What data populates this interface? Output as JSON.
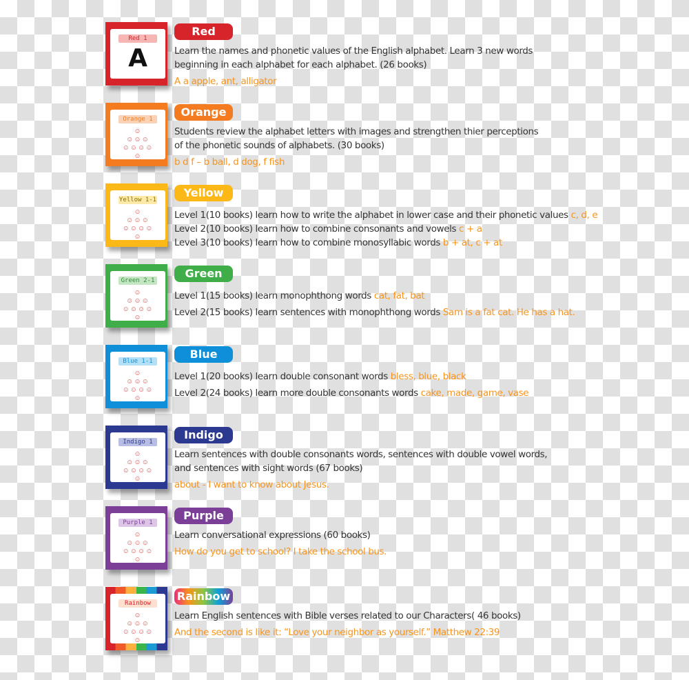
{
  "rows": [
    {
      "label": "Red",
      "color": "#d7232a",
      "cover_title": "Red 1",
      "title_bg": "#f7b6b4",
      "title_color": "#d7232a",
      "cover_letter": "A",
      "lines": [
        {
          "t": "Learn the names and phonetic values of the English alphabet. Learn 3 new words",
          "h": ""
        },
        {
          "t": "beginning in each alphabet for each alphabet. (26 books)",
          "h": ""
        },
        {
          "t": "",
          "h": "A a apple, ant, alligator",
          "gap": true
        }
      ]
    },
    {
      "label": "Orange",
      "color": "#f47b20",
      "cover_title": "Orange 1",
      "title_bg": "#fcd2b4",
      "title_color": "#f47b20",
      "lines": [
        {
          "t": "Students review the alphabet letters with images and strengthen thier perceptions",
          "h": ""
        },
        {
          "t": "of the phonetic sounds of alphabets. (30 books)",
          "h": ""
        },
        {
          "t": "",
          "h": "b d f – b ball, d dog, f fish",
          "gap": true
        }
      ]
    },
    {
      "label": "Yellow",
      "color": "#fbb817",
      "cover_title": "Yellow 1-1",
      "title_bg": "#fde9a8",
      "title_color": "#8a6d00",
      "lines": [
        {
          "t": "Level 1(10 books) learn how to write the alphabet in lower case and their phonetic values ",
          "h": "c, d, e",
          "gap": true
        },
        {
          "t": "Level 2(10 books) learn how to combine consonants and vowels ",
          "h": "c + a"
        },
        {
          "t": "Level 3(10 books) learn how to combine monosyllabic words ",
          "h": "b + at, c + at"
        }
      ]
    },
    {
      "label": "Green",
      "color": "#3fae49",
      "cover_title": "Green 2-1",
      "title_bg": "#c5e6c2",
      "title_color": "#2d8a37",
      "lines": [
        {
          "t": "Level 1(15 books) learn monophthong words ",
          "h": "cat, fat, bat",
          "gap": true
        },
        {
          "t": "Level 2(15 books) learn sentences with monophthong words ",
          "h": "Sam is a fat cat. He has a hat.",
          "gap": true
        }
      ]
    },
    {
      "label": "Blue",
      "color": "#0f8fd7",
      "cover_title": "Blue 1-1",
      "title_bg": "#b3e0f7",
      "title_color": "#0f8fd7",
      "lines": [
        {
          "t": "Level 1(20 books) learn double consonant words ",
          "h": "bless, blue, black",
          "gap": true
        },
        {
          "t": "Level 2(24 books) learn more double consonants words ",
          "h": "cake, made, game, vase",
          "gap": true
        }
      ]
    },
    {
      "label": "Indigo",
      "color": "#2b3990",
      "cover_title": "Indigo 1",
      "title_bg": "#b7bde3",
      "title_color": "#2b3990",
      "lines": [
        {
          "t": "Learn sentences with double consonants words, sentences with double vowel words,",
          "h": ""
        },
        {
          "t": "and sentences with sight words (67 books)",
          "h": ""
        },
        {
          "t": "",
          "h": "about - I want to know about Jesus.",
          "gap": true
        }
      ]
    },
    {
      "label": "Purple",
      "color": "#7b3f98",
      "cover_title": "Purple 1",
      "title_bg": "#dcc5e6",
      "title_color": "#7b3f98",
      "lines": [
        {
          "t": "Learn conversational expressions (60 books)",
          "h": ""
        },
        {
          "t": "",
          "h": "How do you get to school? I take the school bus.",
          "gap": true
        }
      ]
    },
    {
      "label": "Rainbow",
      "color": "linear-gradient(90deg,#ec2d7a,#f7941d,#8cc63f,#0fa0d7,#7b3f98)",
      "cover_title": "Rainbow",
      "title_bg": "#fde0d0",
      "title_color": "#d7232a",
      "lines": [
        {
          "t": "Learn English sentences with Bible verses related to our Characters( 46 books)",
          "h": ""
        },
        {
          "t": "",
          "h": "And the second is like it: “Love your neighbor as yourself.” Matthew 22:39",
          "gap": true
        }
      ]
    }
  ],
  "highlight_color": "#f7941d",
  "kids_illustration": "children-pyramid"
}
